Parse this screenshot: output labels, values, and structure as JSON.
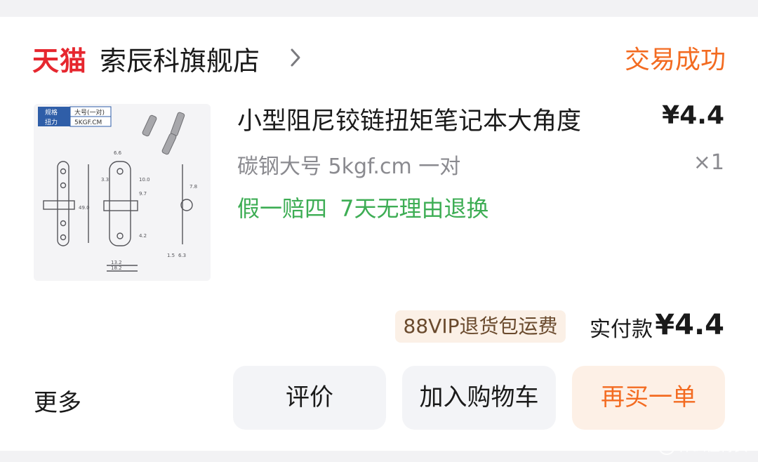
{
  "header": {
    "platform_logo": "天猫",
    "shop_name": "索辰科旗舰店",
    "order_status": "交易成功"
  },
  "product": {
    "title": "小型阻尼铰链扭矩笔记本大角度",
    "price": "¥4.4",
    "sku": "碳钢大号 5kgf.cm 一对",
    "quantity": "×1",
    "guarantee": "假一赔四 7天无理由退换",
    "thumbnail": {
      "spec_label_1": "规格",
      "spec_value_1": "大号(一对)",
      "spec_label_2": "扭力",
      "spec_value_2": "5KGF.CM",
      "dims": [
        "6.6",
        "13.2",
        "18.2",
        "49.0",
        "4.2",
        "9.7",
        "10.0",
        "1.5",
        "6.3",
        "7.8",
        "3.3"
      ]
    }
  },
  "summary": {
    "vip_badge": "88VIP退货包运费",
    "paid_label": "实付款",
    "paid_amount": "¥4.4"
  },
  "actions": {
    "more": "更多",
    "review": "评价",
    "add_to_cart": "加入购物车",
    "buy_again": "再买一单"
  },
  "watermark": "什么值得买",
  "colors": {
    "tmall_red": "#e6272f",
    "status_orange": "#f36b21",
    "guarantee_green": "#3dad54"
  }
}
